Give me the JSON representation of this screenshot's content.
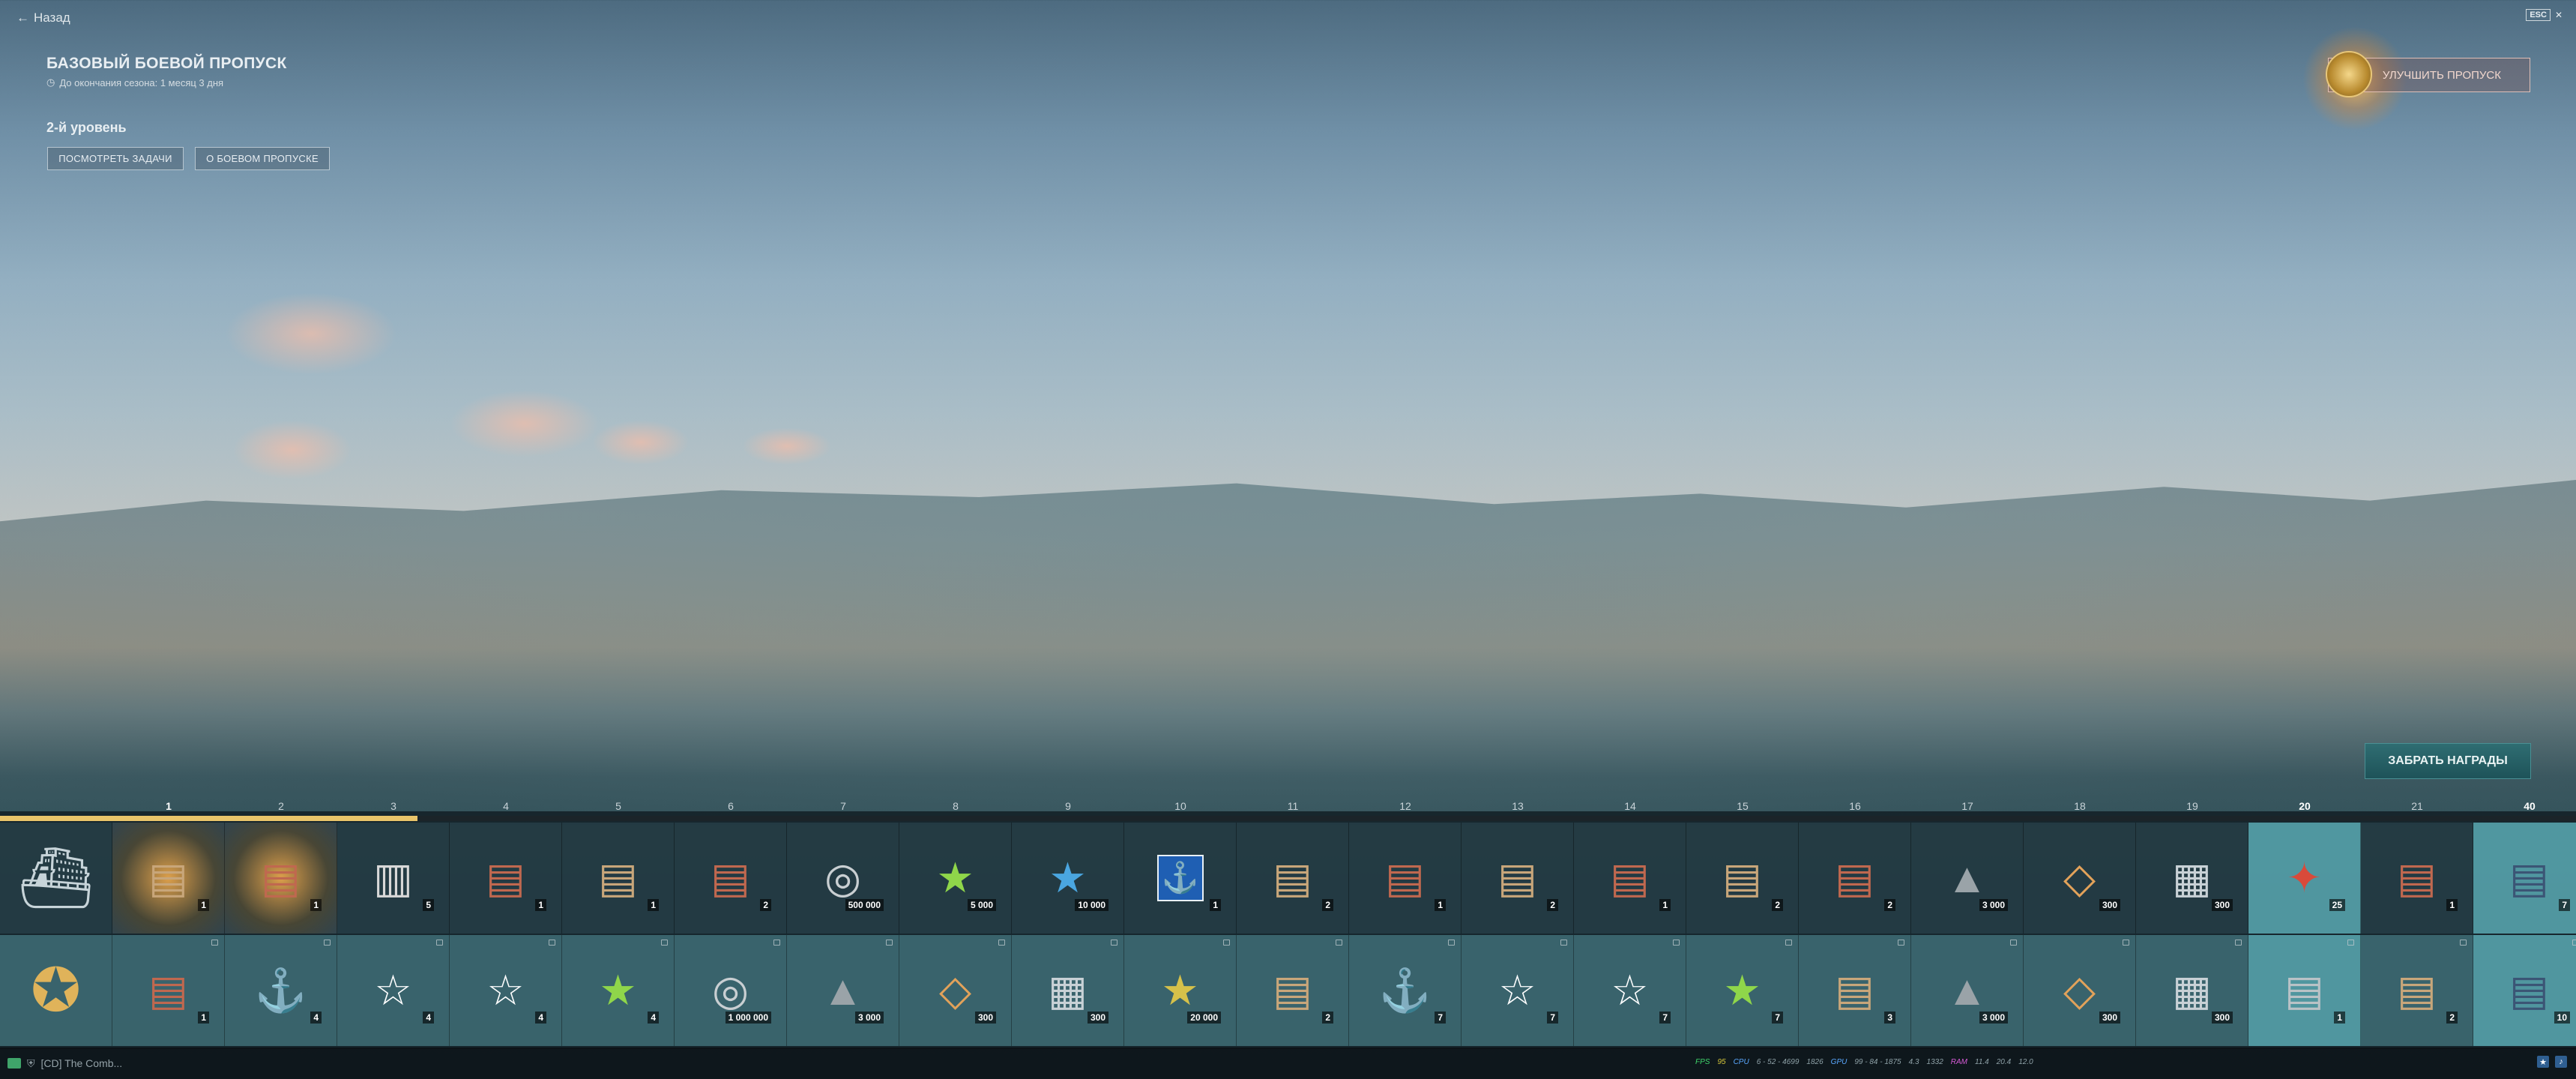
{
  "nav": {
    "back_label": "Назад",
    "esc_label": "ESC"
  },
  "pass": {
    "title": "БАЗОВЫЙ БОЕВОЙ ПРОПУСК",
    "season_remaining": "До окончания сезона: 1 месяц 3 дня",
    "level": "2-й уровень",
    "view_tasks": "ПОСМОТРЕТЬ ЗАДАЧИ",
    "about": "О БОЕВОМ ПРОПУСКЕ",
    "upgrade": "УЛУЧШИТЬ ПРОПУСК",
    "claim": "ЗАБРАТЬ НАГРАДЫ"
  },
  "progress": {
    "percent": 16.2
  },
  "levels": [
    "1",
    "2",
    "3",
    "4",
    "5",
    "6",
    "7",
    "8",
    "9",
    "10",
    "11",
    "12",
    "13",
    "14",
    "15",
    "16",
    "17",
    "18",
    "19",
    "20",
    "21",
    "40"
  ],
  "free_row": [
    {
      "icon": "ship-icon",
      "count": ""
    },
    {
      "icon": "container-icon",
      "count": "1"
    },
    {
      "icon": "red-container-icon",
      "count": "1"
    },
    {
      "icon": "cabinet-icon",
      "count": "5"
    },
    {
      "icon": "red-container-icon",
      "count": "1"
    },
    {
      "icon": "container-icon",
      "count": "1"
    },
    {
      "icon": "red-container-icon",
      "count": "2"
    },
    {
      "icon": "silver-coins-icon",
      "count": "500 000"
    },
    {
      "icon": "green-star-icon",
      "count": "5 000"
    },
    {
      "icon": "blue-stripe-icon",
      "count": "10 000"
    },
    {
      "icon": "anchor-flag-icon",
      "count": "1"
    },
    {
      "icon": "container-icon",
      "count": "2"
    },
    {
      "icon": "red-container-icon",
      "count": "1"
    },
    {
      "icon": "container-icon",
      "count": "2"
    },
    {
      "icon": "red-container-icon",
      "count": "1"
    },
    {
      "icon": "container-icon",
      "count": "2"
    },
    {
      "icon": "red-container-icon",
      "count": "2"
    },
    {
      "icon": "steel-icon",
      "count": "3 000"
    },
    {
      "icon": "gold-diamond-icon",
      "count": "300"
    },
    {
      "icon": "building-icon",
      "count": "300"
    },
    {
      "icon": "red-star-badge-icon",
      "count": "25"
    },
    {
      "icon": "red-container-icon",
      "count": "1"
    },
    {
      "icon": "dark-container-icon",
      "count": "7"
    }
  ],
  "premium_row": [
    {
      "icon": "premium-medal-icon",
      "count": ""
    },
    {
      "icon": "red-container-icon",
      "count": "1"
    },
    {
      "icon": "silver-anchor-icon",
      "count": "4"
    },
    {
      "icon": "white-star-icon",
      "count": "4"
    },
    {
      "icon": "white-star-stripes-icon",
      "count": "4"
    },
    {
      "icon": "green-star-icon",
      "count": "4"
    },
    {
      "icon": "silver-coins-icon",
      "count": "1 000 000"
    },
    {
      "icon": "steel-icon",
      "count": "3 000"
    },
    {
      "icon": "gold-diamond-icon",
      "count": "300"
    },
    {
      "icon": "building-icon",
      "count": "300"
    },
    {
      "icon": "gold-star-icon",
      "count": "20 000"
    },
    {
      "icon": "container-icon",
      "count": "2"
    },
    {
      "icon": "silver-anchor-icon",
      "count": "7"
    },
    {
      "icon": "white-star-icon",
      "count": "7"
    },
    {
      "icon": "white-star-stripes-icon",
      "count": "7"
    },
    {
      "icon": "green-star-icon",
      "count": "7"
    },
    {
      "icon": "container-icon",
      "count": "3"
    },
    {
      "icon": "steel-icon",
      "count": "3 000"
    },
    {
      "icon": "gold-diamond-icon",
      "count": "300"
    },
    {
      "icon": "building-icon",
      "count": "300"
    },
    {
      "icon": "silver-container-icon",
      "count": "1"
    },
    {
      "icon": "container-icon",
      "count": "2"
    },
    {
      "icon": "dark-container-icon",
      "count": "10"
    }
  ],
  "status": {
    "chat": "[CD] The Comb...",
    "perf": [
      "FPS",
      "95",
      "CPU",
      "6 - 52 - 4699",
      "1826",
      "GPU",
      "99 - 84 - 1875",
      "4.3",
      "1332",
      "RAM",
      "11.4",
      "20.4",
      "12.0"
    ]
  },
  "colors": {
    "accent": "#e9c46a",
    "claim_bg": "#24606a",
    "highlight": "#5aaab4"
  }
}
